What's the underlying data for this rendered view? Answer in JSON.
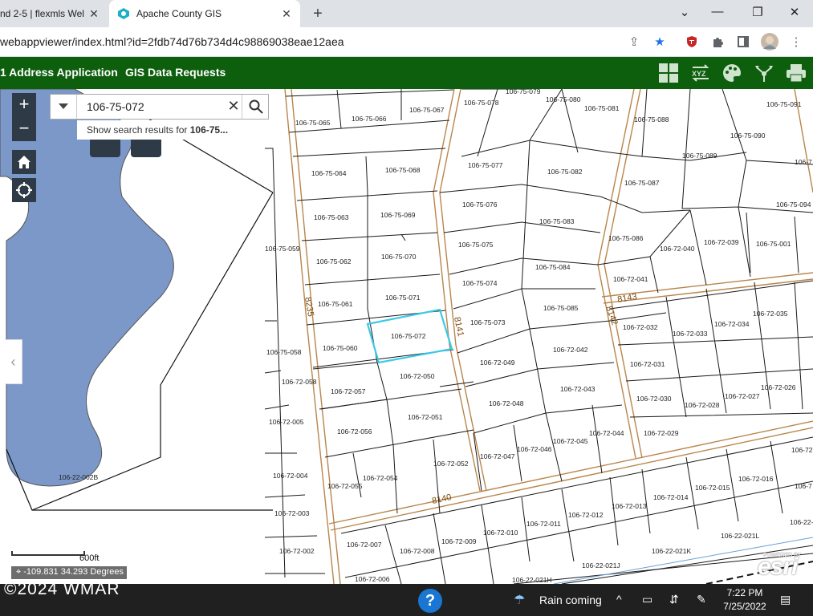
{
  "browser": {
    "tabs": [
      {
        "label": "nd 2-5 | flexmls Wel",
        "active": false
      },
      {
        "label": "Apache County GIS",
        "active": true
      }
    ],
    "new_tab_icon": "plus-icon",
    "url": "webappviewer/index.html?id=2fdb74d76b734d4c98869038eae12aea"
  },
  "app": {
    "nav_links": [
      "1 Address Application",
      "GIS Data Requests"
    ],
    "toolbar_icons": [
      "basemap-gallery-icon",
      "xyz-coordinate-icon",
      "palette-icon",
      "share-icon",
      "print-icon"
    ],
    "header_color": "#0d5e0d"
  },
  "search": {
    "value": "106-75-072",
    "suggestion_prefix": "Show search results for ",
    "suggestion_term": "106-75..."
  },
  "map": {
    "lake_color": "#7b98c9",
    "parcel_outline_color": "#1a1a1a",
    "road_color": "#b8864b",
    "selected_color": "#3cc9e6",
    "selected_parcel": "106-75-072",
    "parcels": [
      "106-75-065",
      "106-75-066",
      "106-75-067",
      "106-75-078",
      "106-75-079",
      "106-75-080",
      "106-75-081",
      "106-75-088",
      "106-75-091",
      "106-75-064",
      "106-75-068",
      "106-75-077",
      "106-75-082",
      "106-75-087",
      "106-75-089",
      "106-75-090",
      "106-7",
      "106-75-063",
      "106-75-069",
      "106-75-076",
      "106-75-083",
      "106-75-094",
      "106-75-059",
      "106-75-062",
      "106-75-070",
      "106-75-075",
      "106-75-084",
      "106-75-086",
      "106-72-040",
      "106-72-039",
      "106-75-001",
      "106-75-061",
      "106-75-071",
      "106-75-074",
      "106-75-085",
      "106-72-041",
      "106-75-058",
      "106-75-060",
      "106-75-072",
      "106-75-073",
      "106-72-042",
      "106-72-032",
      "106-72-033",
      "106-72-034",
      "106-72-035",
      "106-72-058",
      "106-72-057",
      "106-72-050",
      "106-72-049",
      "106-72-031",
      "106-72-026",
      "106-72-005",
      "106-72-056",
      "106-72-051",
      "106-72-048",
      "106-72-043",
      "106-72-030",
      "106-72-028",
      "106-72-027",
      "106-72-004",
      "106-72-055",
      "106-72-054",
      "106-72-052",
      "106-72-047",
      "106-72-046",
      "106-72-045",
      "106-72-044",
      "106-72-029",
      "106-72-003",
      "106-72-013",
      "106-72-014",
      "106-72-015",
      "106-72-016",
      "106-72",
      "106-72-002",
      "106-72-007",
      "106-72-008",
      "106-72-009",
      "106-72-010",
      "106-72-011",
      "106-72-012",
      "106-22-021K",
      "106-22-021L",
      "106-22-",
      "106-72-006",
      "106-22-021H",
      "106-22-021J",
      "106-22-002B",
      "106-7"
    ],
    "roads": [
      "8235",
      "8141",
      "8140",
      "8143",
      "8142"
    ],
    "scale_label": "600ft",
    "coordinates": "-109.831 34.293 Degrees",
    "attribution": "esri",
    "powered_by": "POWERED BY"
  },
  "taskbar": {
    "watermark": "©2024 WMAR",
    "weather": "Rain coming",
    "time": "7:22 PM",
    "date": "7/25/2022"
  }
}
